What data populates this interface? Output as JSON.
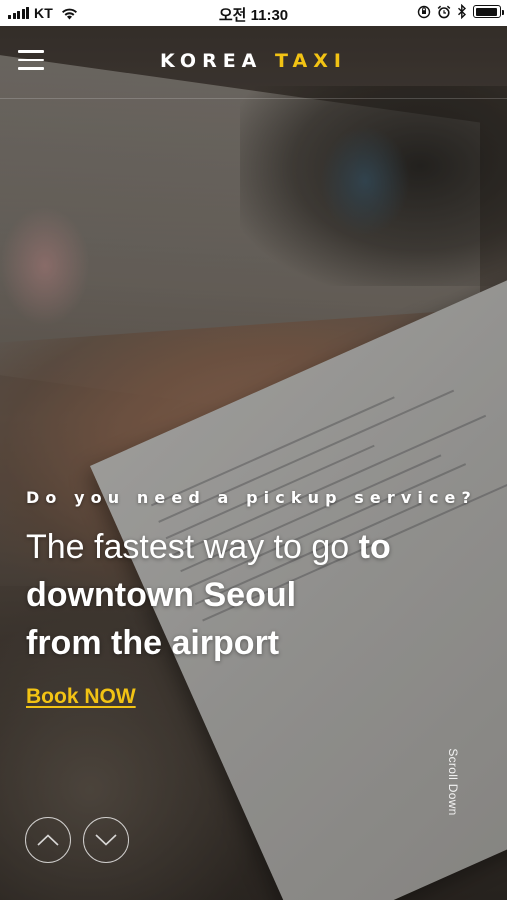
{
  "status_bar": {
    "carrier": "KT",
    "time": "오전 11:30",
    "battery_level": 0.95
  },
  "header": {
    "brand_primary": "KOREA",
    "brand_accent": "TAXI",
    "menu_icon": "hamburger-menu-icon"
  },
  "hero": {
    "eyebrow": "Do you need a pickup service?",
    "headline_light": "The fastest way to go ",
    "headline_bold_1": "to",
    "headline_bold_2": "downtown Seoul",
    "headline_bold_3": "from the airport",
    "cta_label": "Book NOW",
    "scroll_label": "Scroll Down"
  },
  "nav": {
    "prev_icon": "chevron-up-icon",
    "next_icon": "chevron-down-icon"
  },
  "colors": {
    "accent": "#f2c314",
    "text": "#ffffff",
    "status_bar_bg": "#ffffff"
  }
}
